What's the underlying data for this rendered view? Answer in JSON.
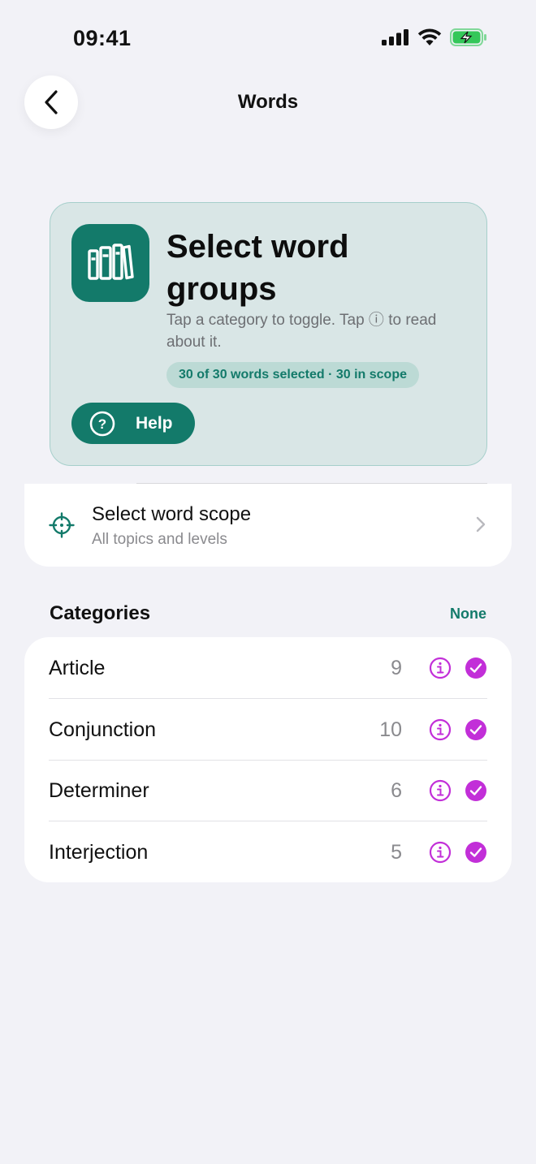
{
  "status_bar": {
    "time": "09:41"
  },
  "nav": {
    "title": "Words"
  },
  "hero": {
    "title": "Select word groups",
    "description": "Tap a category to toggle. Tap ⓘ to read about it.",
    "selection_summary": "30 of 30 words selected · 30 in scope",
    "help_label": "Help",
    "icon": "books-icon"
  },
  "scope": {
    "title": "Select word scope",
    "subtitle": "All topics and levels",
    "icon": "target-icon"
  },
  "categories": {
    "header": "Categories",
    "none_label": "None",
    "items": [
      {
        "name": "Article",
        "count": "9",
        "selected": true
      },
      {
        "name": "Conjunction",
        "count": "10",
        "selected": true
      },
      {
        "name": "Determiner",
        "count": "6",
        "selected": true
      },
      {
        "name": "Interjection",
        "count": "5",
        "selected": true
      }
    ]
  },
  "colors": {
    "accent": "#137a6a",
    "check": "#c22fd8",
    "background": "#f2f2f7"
  }
}
